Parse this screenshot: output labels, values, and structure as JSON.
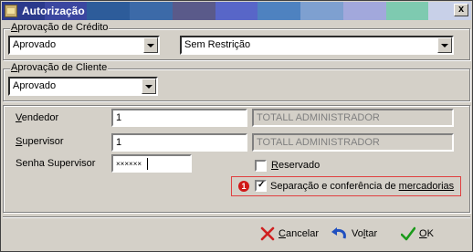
{
  "window": {
    "title": "Autorização",
    "close_glyph": "x",
    "title_band_colors": [
      "#2b3a8c",
      "#3b47a0",
      "#2d5c9a",
      "#3c6aa8",
      "#5a5a8a",
      "#5866c8",
      "#4e82c0",
      "#7ea0d0",
      "#a2a8dc",
      "#7ecab0",
      "#c8d0e8"
    ]
  },
  "credit_group": {
    "title": "Aprovação de Crédito",
    "status_value": "Aprovado",
    "restriction_value": "Sem Restrição"
  },
  "client_group": {
    "title": "Aprovação de Cliente",
    "status_value": "Aprovado"
  },
  "form": {
    "vendedor_label": "Vendedor",
    "vendedor_code": "1",
    "vendedor_name": "TOTALL ADMINISTRADOR",
    "supervisor_label": "Supervisor",
    "supervisor_code": "1",
    "supervisor_name": "TOTALL ADMINISTRADOR",
    "password_label": "Senha Supervisor",
    "password_value": "××××××",
    "reservado_label": "Reservado",
    "reservado_checked": false,
    "separacao_label": "Separação e conferência de mercadorias",
    "separacao_checked": true,
    "badge_number": "1"
  },
  "buttons": {
    "cancel_label": "Cancelar",
    "back_label": "Voltar",
    "ok_label": "OK"
  },
  "colors": {
    "cancel_icon": "#d02020",
    "back_icon": "#2050c0",
    "ok_icon": "#1a9a1a",
    "highlight": "#e04040"
  }
}
